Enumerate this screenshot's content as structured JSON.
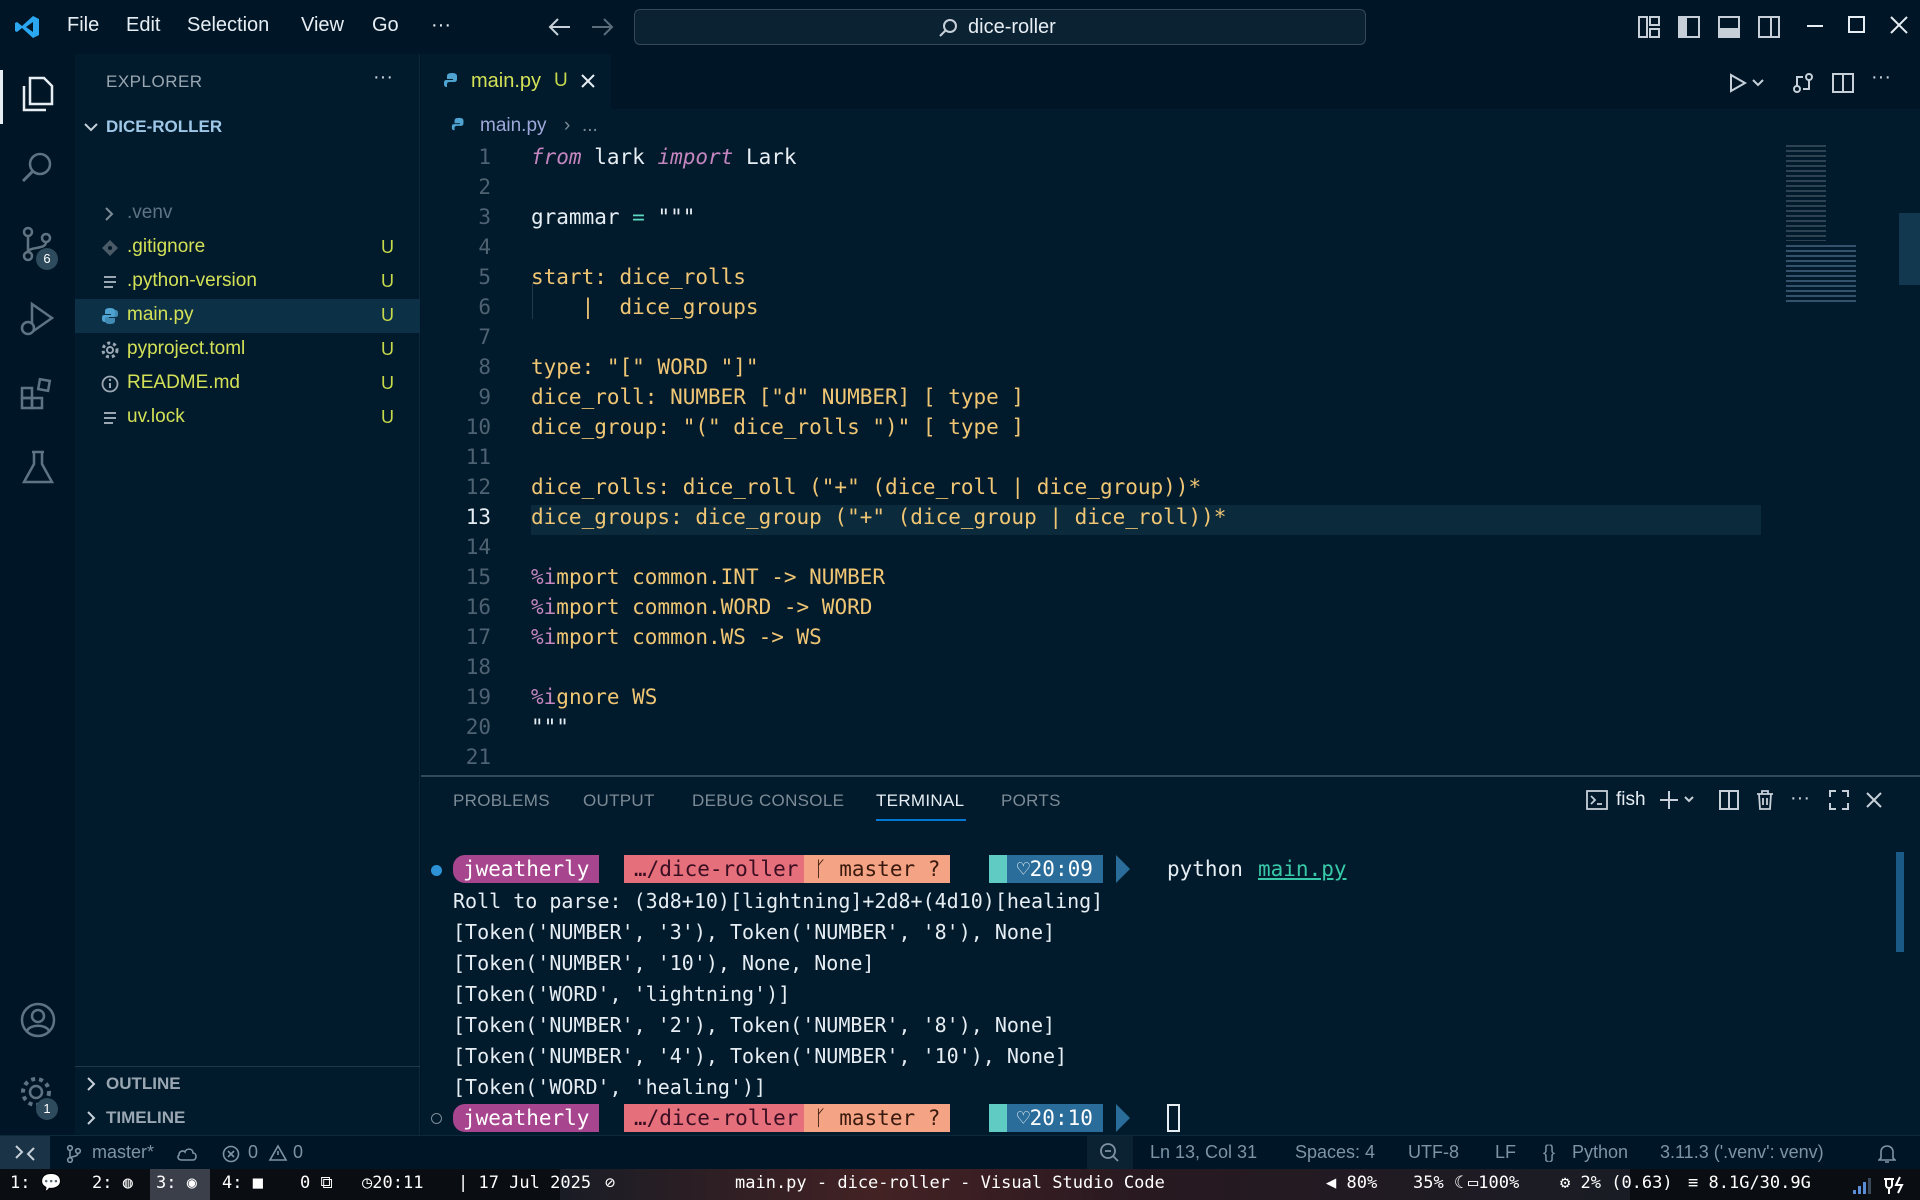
{
  "menu": {
    "file": "File",
    "edit": "Edit",
    "selection": "Selection",
    "view": "View",
    "go": "Go",
    "more": "···"
  },
  "search": {
    "text": "dice-roller"
  },
  "activity": {
    "scm_badge": "6",
    "settings_badge": "1"
  },
  "explorer": {
    "title": "EXPLORER",
    "project": "DICE-ROLLER",
    "items": [
      {
        "label": ".venv",
        "badge": ""
      },
      {
        "label": ".gitignore",
        "badge": "U"
      },
      {
        "label": ".python-version",
        "badge": "U"
      },
      {
        "label": "main.py",
        "badge": "U"
      },
      {
        "label": "pyproject.toml",
        "badge": "U"
      },
      {
        "label": "README.md",
        "badge": "U"
      },
      {
        "label": "uv.lock",
        "badge": "U"
      }
    ],
    "outline": "OUTLINE",
    "timeline": "TIMELINE"
  },
  "editor": {
    "tab_label": "main.py",
    "tab_badge": "U",
    "breadcrumb_file": "main.py",
    "breadcrumb_more": "...",
    "line_numbers": [
      "1",
      "2",
      "3",
      "4",
      "5",
      "6",
      "7",
      "8",
      "9",
      "10",
      "11",
      "12",
      "13",
      "14",
      "15",
      "16",
      "17",
      "18",
      "19",
      "20",
      "21"
    ],
    "code": {
      "l1_from": "from",
      "l1_mod": " lark ",
      "l1_import": "import",
      "l1_name": " Lark",
      "l3_name": "grammar ",
      "l3_eq": "=",
      "l3_str": " \"\"\"",
      "l5": "start: dice_rolls",
      "l6": "    |  dice_groups",
      "l8": "type: \"[\" WORD \"]\"",
      "l9": "dice_roll: NUMBER [\"d\" NUMBER] [ type ]",
      "l10": "dice_group: \"(\" dice_rolls \")\" [ type ]",
      "l12": "dice_rolls: dice_roll (\"+\" (dice_roll | dice_group))*",
      "l13": "dice_groups: dice_group (\"+\" (dice_group | dice_roll))*",
      "l15_pct": "%i",
      "l15": "mport common.INT -> NUMBER",
      "l16_pct": "%i",
      "l16": "mport common.WORD -> WORD",
      "l17_pct": "%i",
      "l17": "mport common.WS -> WS",
      "l19_pct": "%i",
      "l19": "gnore WS",
      "l20": "\"\"\""
    }
  },
  "panel": {
    "tabs": {
      "problems": "PROBLEMS",
      "output": "OUTPUT",
      "debug": "DEBUG CONSOLE",
      "terminal": "TERMINAL",
      "ports": "PORTS"
    },
    "shell": "fish"
  },
  "terminal": {
    "prompt1": {
      "user": "jweatherly",
      "dir": "…/dice-roller",
      "branch": "master ?",
      "time": "20:09",
      "command": "python",
      "arg": "main.py"
    },
    "lines": [
      "Roll to parse: (3d8+10)[lightning]+2d8+(4d10)[healing]",
      "[Token('NUMBER', '3'), Token('NUMBER', '8'), None]",
      "[Token('NUMBER', '10'), None, None]",
      "[Token('WORD', 'lightning')]",
      "[Token('NUMBER', '2'), Token('NUMBER', '8'), None]",
      "[Token('NUMBER', '4'), Token('NUMBER', '10'), None]",
      "[Token('WORD', 'healing')]"
    ],
    "prompt2": {
      "user": "jweatherly",
      "dir": "…/dice-roller",
      "branch": "master ?",
      "time": "20:10"
    }
  },
  "status": {
    "branch": "master*",
    "errors": "0",
    "warnings": "0",
    "position": "Ln 13, Col 31",
    "spaces": "Spaces: 4",
    "encoding": "UTF-8",
    "eol": "LF",
    "language": "Python",
    "interpreter": "3.11.3 ('.venv': venv)"
  },
  "taskbar": {
    "ws1": "1:",
    "ws2": "2:",
    "ws3": "3:",
    "ws4": "4:",
    "ws0": "0",
    "clock": "20:11",
    "date": "| 17 Jul 2025",
    "title": "main.py - dice-roller - Visual Studio Code",
    "volume": "80%",
    "brightness": "35%",
    "battery": "100%",
    "cpu": "2% (0.63)",
    "memory": "8.1G/30.9G"
  },
  "colors": {
    "accent": "#0078d4",
    "untracked": "#d4e157",
    "bg": "#011b2c"
  }
}
